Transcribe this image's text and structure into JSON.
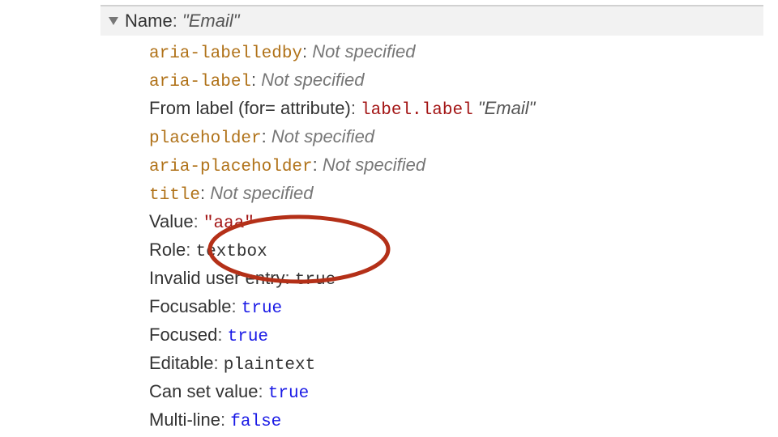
{
  "header": {
    "label": "Name",
    "value": "Email"
  },
  "rows": {
    "aria_labelledby": {
      "attr": "aria-labelledby",
      "val": "Not specified"
    },
    "aria_label": {
      "attr": "aria-label",
      "val": "Not specified"
    },
    "from_label": {
      "label": "From label (for= attribute)",
      "selector": "label.label",
      "value": "Email"
    },
    "placeholder": {
      "attr": "placeholder",
      "val": "Not specified"
    },
    "aria_placeholder": {
      "attr": "aria-placeholder",
      "val": "Not specified"
    },
    "title": {
      "attr": "title",
      "val": "Not specified"
    },
    "value_row": {
      "label": "Value",
      "val": "aaa"
    },
    "role": {
      "label": "Role",
      "val": "textbox"
    },
    "invalid": {
      "label": "Invalid user entry",
      "val": "true"
    },
    "focusable": {
      "label": "Focusable",
      "val": "true"
    },
    "focused": {
      "label": "Focused",
      "val": "true"
    },
    "editable": {
      "label": "Editable",
      "val": "plaintext"
    },
    "cansetvalue": {
      "label": "Can set value",
      "val": "true"
    },
    "multiline": {
      "label": "Multi-line",
      "val": "false"
    }
  },
  "glyphs": {
    "quote": "\"",
    "colon_space": ": "
  }
}
